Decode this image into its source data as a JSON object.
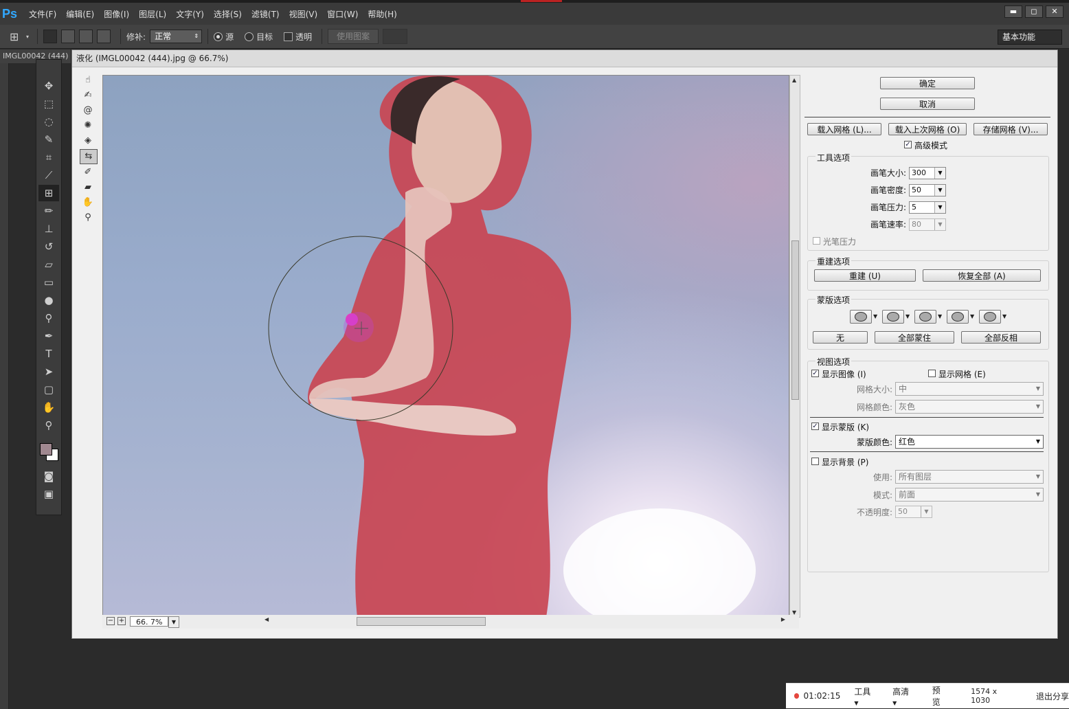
{
  "app": {
    "logo": "Ps"
  },
  "menubar": {
    "items": [
      "文件(F)",
      "编辑(E)",
      "图像(I)",
      "图层(L)",
      "文字(Y)",
      "选择(S)",
      "滤镜(T)",
      "视图(V)",
      "窗口(W)",
      "帮助(H)"
    ],
    "window_controls": [
      "▬",
      "◻",
      "✕"
    ]
  },
  "options": {
    "patch_label": "修补:",
    "patch_value": "正常",
    "source": "源",
    "target": "目标",
    "transparent": "透明",
    "use_pattern": "使用图案",
    "workspace": "基本功能"
  },
  "doc_tab": "IMGL00042 (444)",
  "dialog": {
    "title": "液化 (IMGL00042 (444).jpg @ 66.7%)",
    "zoom": "66. 7%",
    "ok": "确定",
    "cancel": "取消",
    "load_mesh": "载入网格 (L)...",
    "load_last_mesh": "载入上次网格 (O)",
    "save_mesh": "存储网格 (V)...",
    "advanced_mode": "高级模式",
    "tool_options": {
      "title": "工具选项",
      "brush_size_label": "画笔大小:",
      "brush_size": "300",
      "brush_density_label": "画笔密度:",
      "brush_density": "50",
      "brush_pressure_label": "画笔压力:",
      "brush_pressure": "5",
      "brush_rate_label": "画笔速率:",
      "brush_rate": "80",
      "stylus_pressure": "光笔压力"
    },
    "reconstruct": {
      "title": "重建选项",
      "reconstruct": "重建 (U)",
      "restore_all": "恢复全部 (A)"
    },
    "mask": {
      "title": "蒙版选项",
      "none": "无",
      "mask_all": "全部蒙住",
      "invert_all": "全部反相"
    },
    "view": {
      "title": "视图选项",
      "show_image": "显示图像 (I)",
      "show_mesh": "显示网格 (E)",
      "mesh_size_label": "网格大小:",
      "mesh_size": "中",
      "mesh_color_label": "网格颜色:",
      "mesh_color": "灰色",
      "show_mask": "显示蒙版 (K)",
      "mask_color_label": "蒙版颜色:",
      "mask_color": "红色",
      "show_backdrop": "显示背景 (P)",
      "use_label": "使用:",
      "use": "所有图层",
      "mode_label": "模式:",
      "mode": "前面",
      "opacity_label": "不透明度:",
      "opacity": "50"
    }
  },
  "recorder": {
    "time": "01:02:15",
    "tools": "工具",
    "quality": "高清",
    "preview": "预览",
    "resolution": "1574 x 1030",
    "exit": "退出分享"
  }
}
